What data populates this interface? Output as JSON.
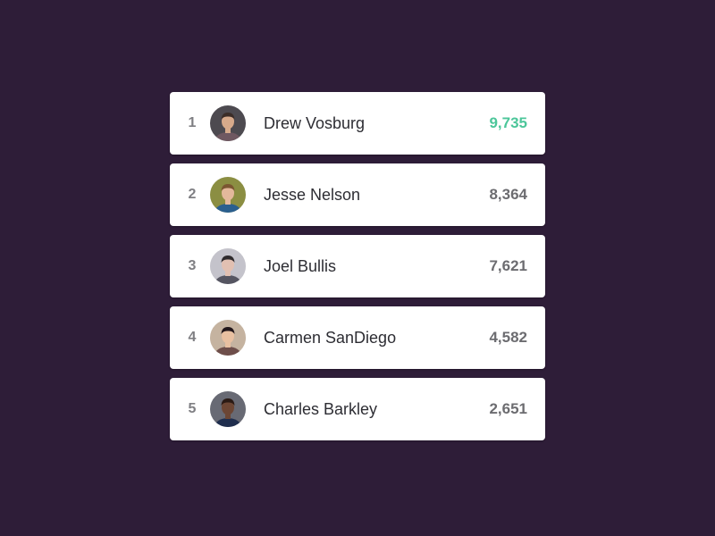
{
  "colors": {
    "background": "#2e1d38",
    "card": "#ffffff",
    "rank": "#7f7f83",
    "name": "#2d2d33",
    "score": "#6c6c70",
    "leader_score": "#4cc69a"
  },
  "leaderboard": {
    "entries": [
      {
        "rank": "1",
        "name": "Drew Vosburg",
        "score": "9,735",
        "highlight": true,
        "avatar": {
          "icon": "avatar-drew-vosburg",
          "bg": "#4d4a50",
          "skin": "#d7aa8b",
          "hair": "#3b2d28",
          "shirt": "#6f5861"
        }
      },
      {
        "rank": "2",
        "name": "Jesse Nelson",
        "score": "8,364",
        "highlight": false,
        "avatar": {
          "icon": "avatar-jesse-nelson",
          "bg": "#8b8e42",
          "skin": "#e3b89b",
          "hair": "#7b5631",
          "shirt": "#2a5f8e"
        }
      },
      {
        "rank": "3",
        "name": "Joel Bullis",
        "score": "7,621",
        "highlight": false,
        "avatar": {
          "icon": "avatar-joel-bullis",
          "bg": "#c4c3cb",
          "skin": "#e1c0b2",
          "hair": "#2e2a2d",
          "shirt": "#555561"
        }
      },
      {
        "rank": "4",
        "name": "Carmen SanDiego",
        "score": "4,582",
        "highlight": false,
        "avatar": {
          "icon": "avatar-carmen-sandiego",
          "bg": "#c5b3a0",
          "skin": "#e8c0a1",
          "hair": "#21161a",
          "shirt": "#6e4e4a"
        }
      },
      {
        "rank": "5",
        "name": "Charles Barkley",
        "score": "2,651",
        "highlight": false,
        "avatar": {
          "icon": "avatar-charles-barkley",
          "bg": "#686a74",
          "skin": "#6c4634",
          "hair": "#2a1a14",
          "shirt": "#1f2e4e"
        }
      }
    ]
  }
}
